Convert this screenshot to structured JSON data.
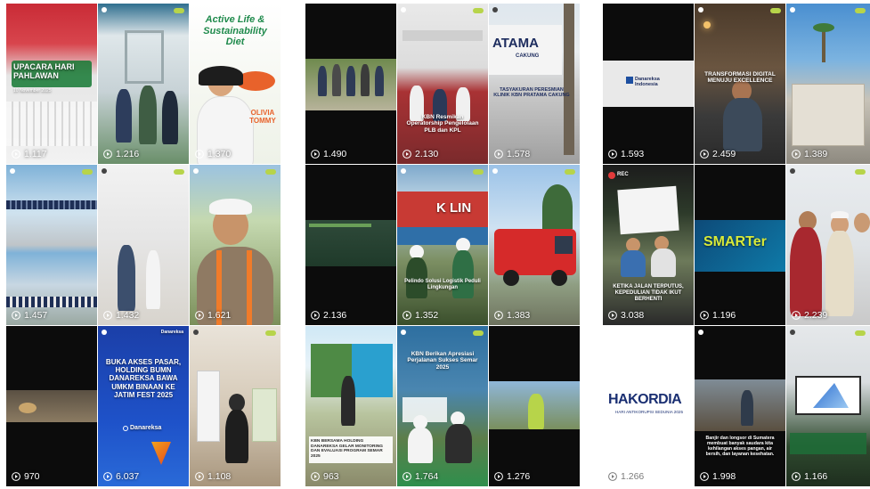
{
  "groups": [
    {
      "tiles": [
        {
          "views": "1.117",
          "caption": "UPACARA HARI PAHLAWAN",
          "subcaption": "10 November 2025"
        },
        {
          "views": "1.216"
        },
        {
          "views": "1.370",
          "caption": "Active Life & Sustainability Diet",
          "name": "OLIVIA TOMMY"
        },
        {
          "views": "1.457"
        },
        {
          "views": "1.432"
        },
        {
          "views": "1.621"
        },
        {
          "views": "970"
        },
        {
          "views": "6.037",
          "caption": "BUKA AKSES PASAR, HOLDING BUMN DANAREKSA BAWA UMKM BINAAN KE JATIM FEST 2025",
          "brand": "Danareksa"
        },
        {
          "views": "1.108"
        }
      ]
    },
    {
      "tiles": [
        {
          "views": "1.490"
        },
        {
          "views": "2.130",
          "caption": "KBN Resmikan Operatorship Pengelolaan PLB dan KPL"
        },
        {
          "views": "1.578",
          "sign": "ATAMA",
          "sign_sub": "CAKUNG",
          "caption": "TASYAKURAN PERESMIAN KLINIK KBN PRATAMA CAKUNG"
        },
        {
          "views": "2.136"
        },
        {
          "views": "1.352",
          "container": "K LIN",
          "caption": "Pelindo Solusi Logistik Peduli Lingkungan"
        },
        {
          "views": "1.383"
        },
        {
          "views": "963",
          "caption": "KBN BERSAMA HOLDING DANAREKSA GELAR MONITORING DAN EVALUASI PROGRAM SEMAR 2025"
        },
        {
          "views": "1.764",
          "caption": "KBN Berikan Apresiasi Perjalanan Sukses Semar 2025"
        },
        {
          "views": "1.276"
        }
      ]
    },
    {
      "tiles": [
        {
          "views": "1.593",
          "brand": "Danareksa Indonesia"
        },
        {
          "views": "2.459",
          "caption": "TRANSFORMASI DIGITAL MENUJU EXCELLENCE"
        },
        {
          "views": "1.389"
        },
        {
          "views": "3.038",
          "rec": "REC",
          "caption": "KETIKA JALAN TERPUTUS, KEPEDULIAN TIDAK IKUT BERHENTI"
        },
        {
          "views": "1.196",
          "caption": "SMARTer"
        },
        {
          "views": "2.239"
        },
        {
          "views": "1.266",
          "caption": "HAKORDIA",
          "subcaption": "HARI ANTIKORUPSI SEDUNIA 2025"
        },
        {
          "views": "1.998",
          "caption": "Banjir dan longsor di Sumatera membuat banyak saudara kita kehilangan akses pangan, air bersih, dan layanan kesehatan."
        },
        {
          "views": "1.166"
        }
      ]
    }
  ],
  "icons": {
    "views": "play-icon"
  },
  "colors": {
    "accent": "#b7d44a",
    "text": "#ffffff"
  }
}
